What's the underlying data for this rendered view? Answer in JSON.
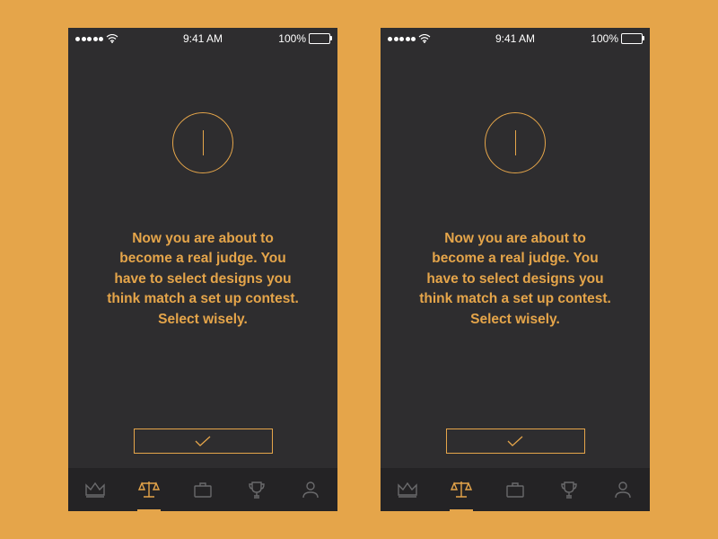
{
  "status_bar": {
    "time": "9:41 AM",
    "battery_pct": "100%"
  },
  "screens": [
    {
      "message_line1": "Now you are about to become a real judge. You have to select designs you think match a set up contest.",
      "message_line2": "Select wisely."
    },
    {
      "message_line1": "Now you are about to become a real judge. You have to select designs you think match a set up contest.",
      "message_line2": "Select wisely."
    }
  ],
  "tabs": [
    {
      "name": "crown",
      "active": false
    },
    {
      "name": "scales",
      "active": true
    },
    {
      "name": "briefcase",
      "active": false
    },
    {
      "name": "trophy",
      "active": false
    },
    {
      "name": "profile",
      "active": false
    }
  ]
}
